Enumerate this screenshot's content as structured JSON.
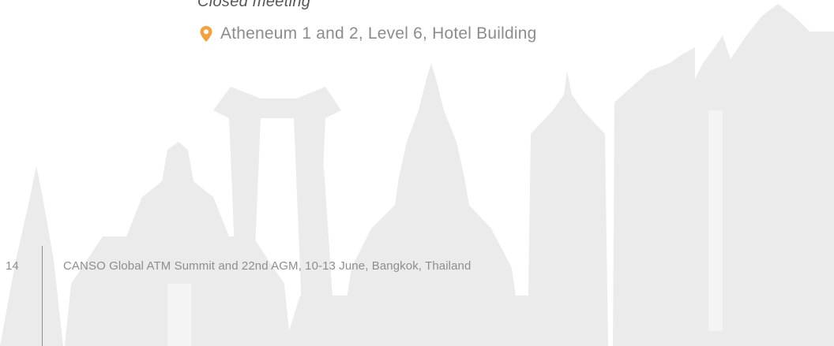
{
  "event": {
    "meeting_type": "Closed meeting",
    "location": "Atheneum 1 and 2, Level 6, Hotel Building",
    "location_icon": "map-pin-icon",
    "accent_color": "#f5a13a"
  },
  "footer": {
    "page_number": "14",
    "title": "CANSO Global ATM Summit and 22nd AGM, 10-13 June, Bangkok, Thailand"
  },
  "background": {
    "illustration": "bangkok-skyline-silhouette",
    "silhouette_color": "#ebebeb"
  }
}
